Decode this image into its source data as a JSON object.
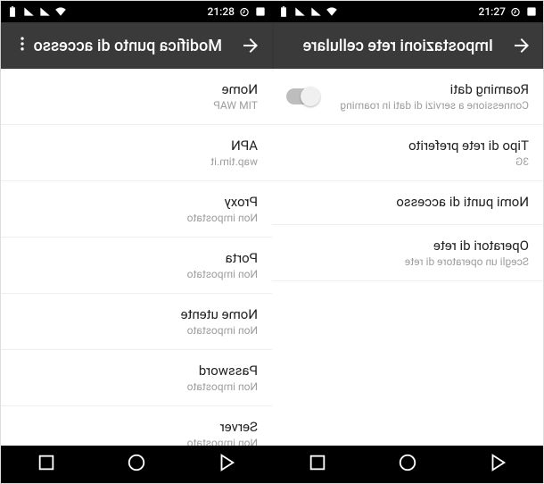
{
  "left": {
    "status_time": "21:27",
    "appbar_title": "Impostazioni rete cellulare",
    "items": [
      {
        "primary": "Roaming dati",
        "secondary": "Connessione a servizi di dati in roaming",
        "toggle": true
      },
      {
        "primary": "Tipo di rete preferito",
        "secondary": "3G"
      },
      {
        "primary": "Nomi punti di accesso",
        "secondary": ""
      },
      {
        "primary": "Operatori di rete",
        "secondary": "Scegli un operatore di rete"
      }
    ]
  },
  "right": {
    "status_time": "21:28",
    "appbar_title": "Modifica punto di accesso",
    "items": [
      {
        "primary": "Nome",
        "secondary": "TIM WAP"
      },
      {
        "primary": "APN",
        "secondary": "wap.tim.it"
      },
      {
        "primary": "Proxy",
        "secondary": "Non impostato"
      },
      {
        "primary": "Porta",
        "secondary": "Non impostato"
      },
      {
        "primary": "Nome utente",
        "secondary": "Non impostato"
      },
      {
        "primary": "Password",
        "secondary": "Non impostato"
      },
      {
        "primary": "Server",
        "secondary": "Non impostato"
      }
    ]
  }
}
